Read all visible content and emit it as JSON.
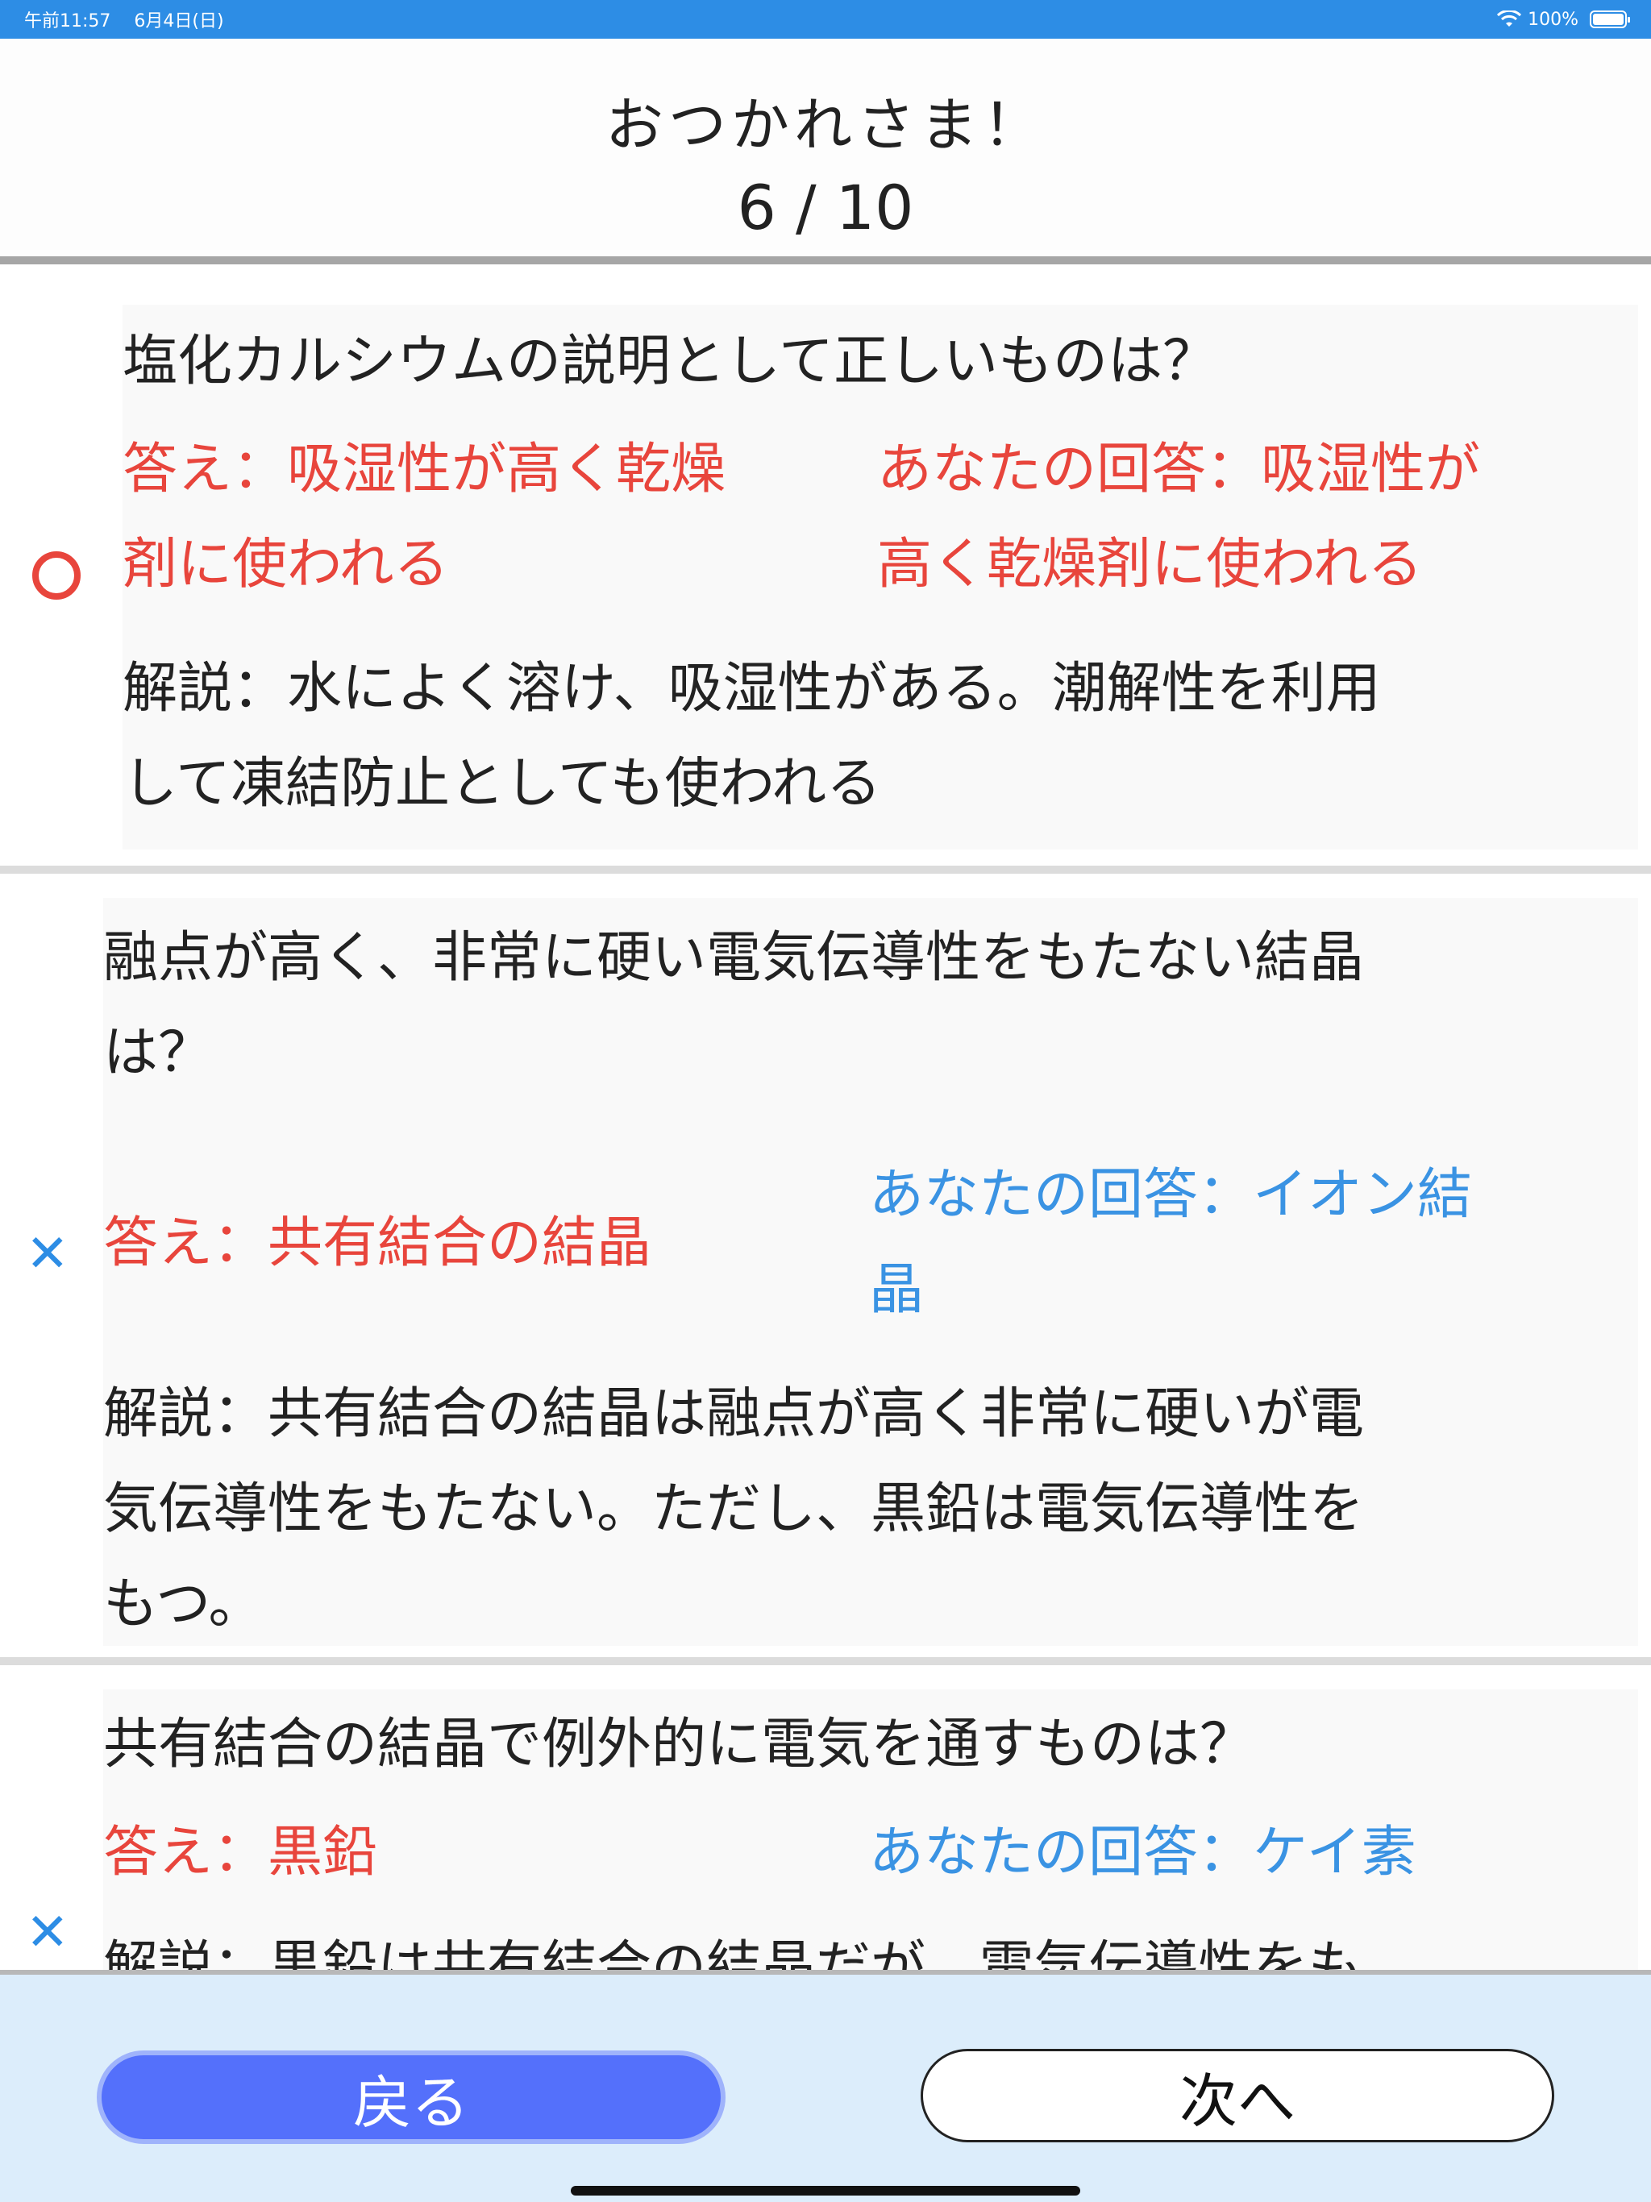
{
  "status_bar": {
    "time": "午前11:57",
    "date": "6月4日(日)",
    "battery": "100%"
  },
  "header": {
    "title": "おつかれさま！",
    "score": "6 / 10"
  },
  "items": [
    {
      "result": "correct",
      "question": "塩化カルシウムの説明として正しいものは？",
      "answer_line1": "答え：吸湿性が高く乾燥",
      "answer_line2": "剤に使われる",
      "your_line1": "あなたの回答：吸湿性が",
      "your_line2": "高く乾燥剤に使われる",
      "exp_line1": "解説：水によく溶け、吸湿性がある。潮解性を利用",
      "exp_line2": "して凍結防止としても使われる"
    },
    {
      "result": "wrong",
      "question_line1": "融点が高く、非常に硬い電気伝導性をもたない結晶",
      "question_line2": "は？",
      "answer_line1": "答え：共有結合の結晶",
      "your_line1": "あなたの回答：イオン結",
      "your_line2": "晶",
      "exp_line1": "解説：共有結合の結晶は融点が高く非常に硬いが電",
      "exp_line2": "気伝導性をもたない。ただし、黒鉛は電気伝導性を",
      "exp_line3": "もつ。"
    },
    {
      "result": "wrong",
      "question": "共有結合の結晶で例外的に電気を通すものは？",
      "answer_line1": "答え：黒鉛",
      "your_line1": "あなたの回答：ケイ素",
      "exp_line1": "解説：黒鉛は共有結合の結晶だが、電気伝導性をも"
    }
  ],
  "footer": {
    "back_label": "戻る",
    "next_label": "次へ"
  }
}
